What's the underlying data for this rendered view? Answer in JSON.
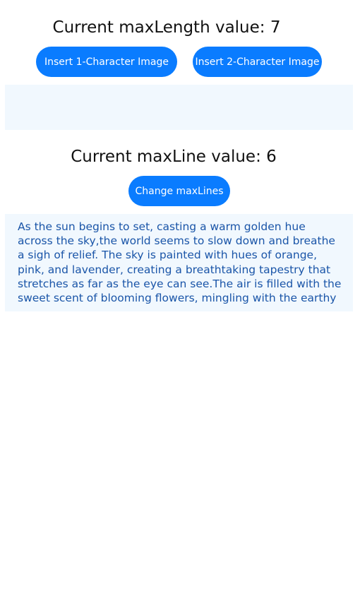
{
  "section1": {
    "title": "Current maxLength value: 7",
    "insert1_label": "Insert 1-Character Image",
    "insert2_label": "Insert 2-Character Image",
    "editor_text": ""
  },
  "section2": {
    "title": "Current maxLine value: 6",
    "change_label": "Change maxLines",
    "editor_text": "As the sun begins to set, casting a warm golden hue across the sky,the world seems to slow down and breathe a sigh of relief. The sky is painted with hues of orange, pink, and lavender, creating a breathtaking tapestry that stretches as far as the eye can see.The air is filled with the sweet scent of blooming flowers, mingling with the earthy"
  },
  "colors": {
    "button": "#0a7cff",
    "editor_bg": "#f1f8fe",
    "editor_text": "#1a55a8"
  }
}
